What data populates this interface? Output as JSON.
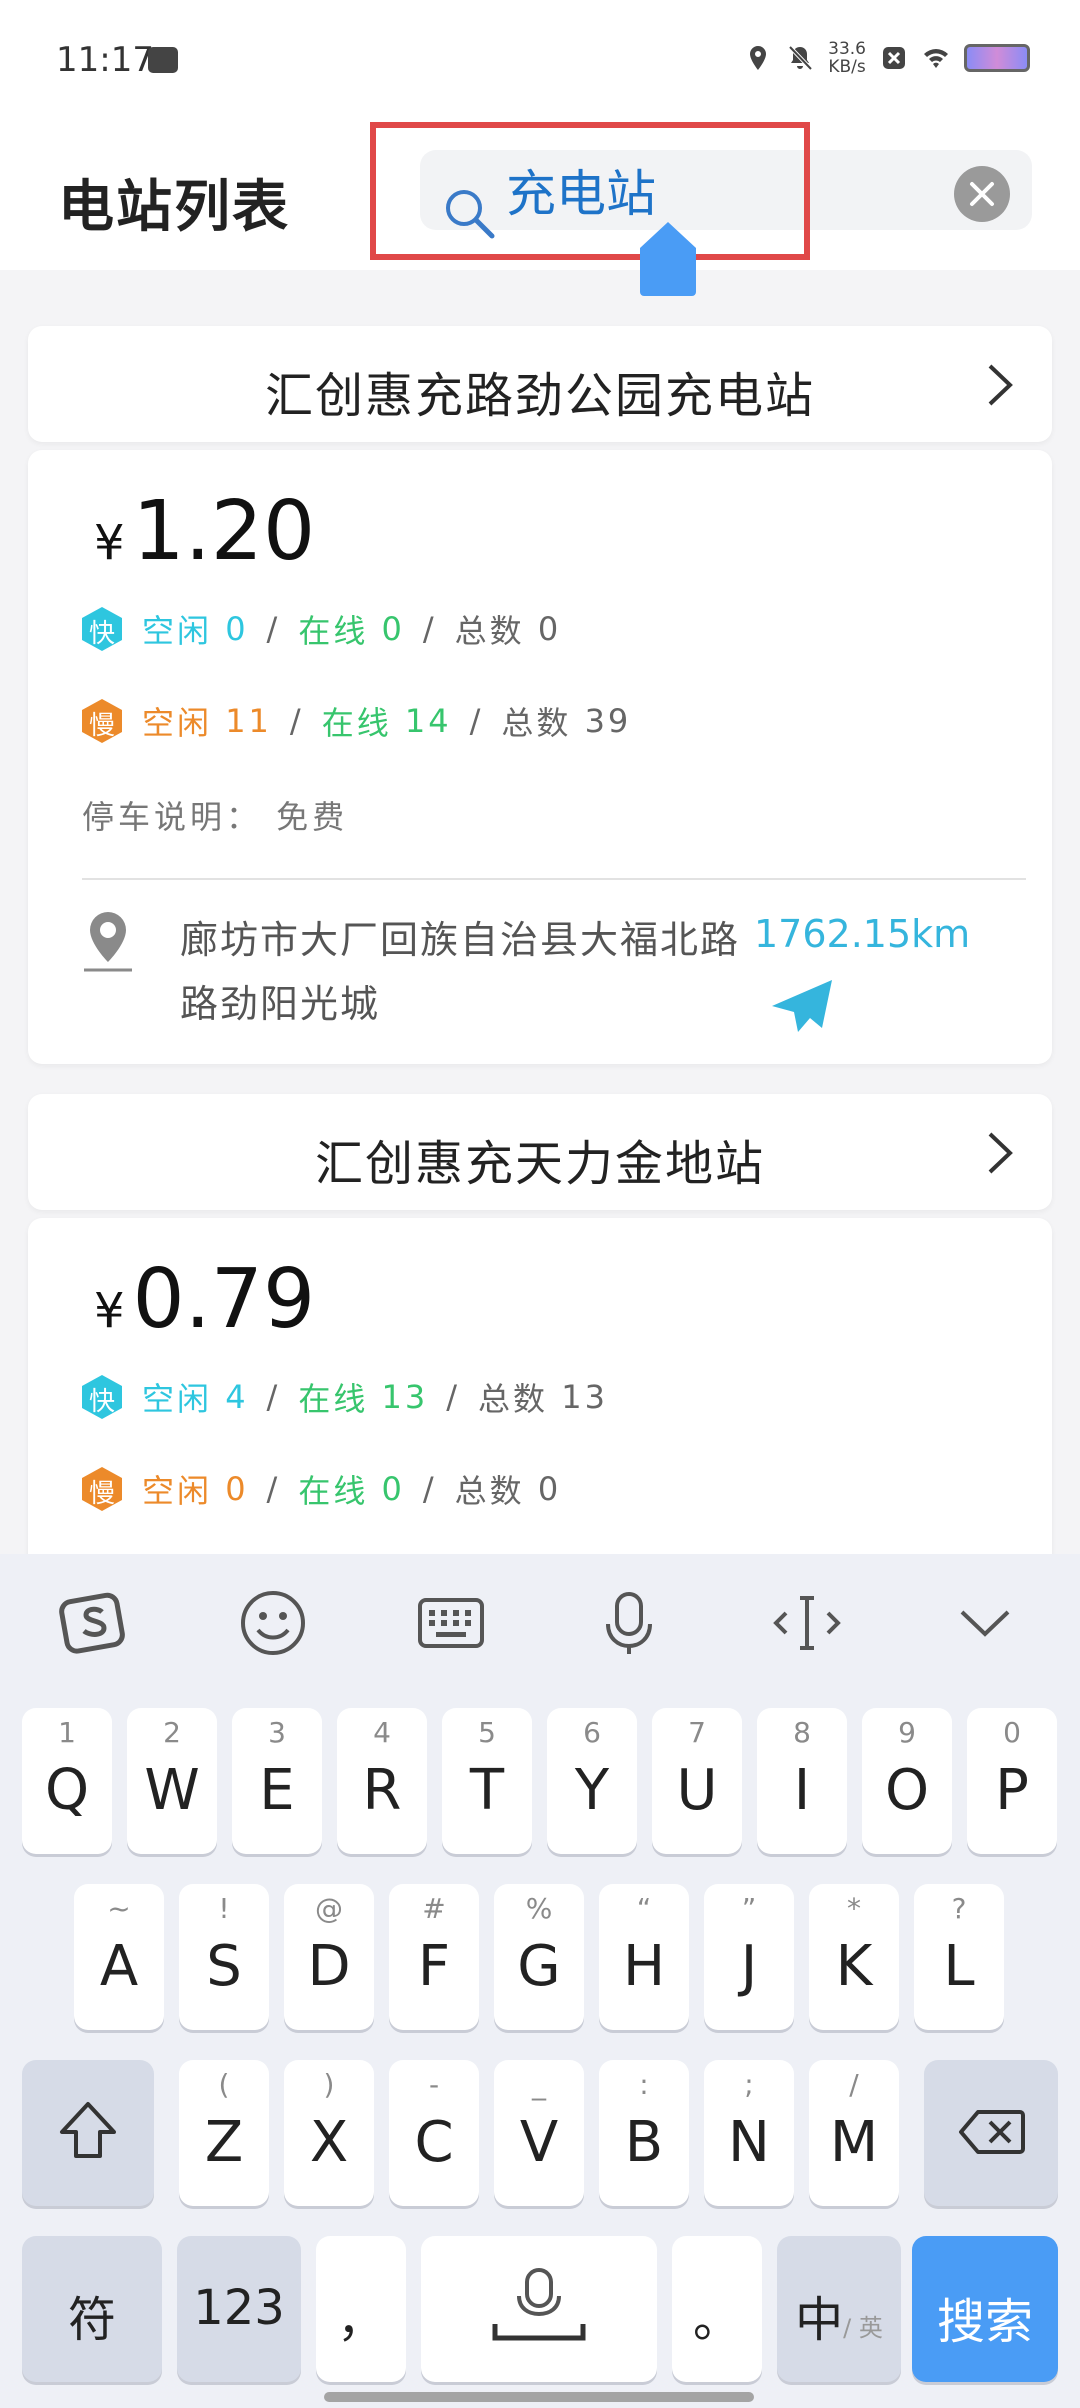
{
  "status_bar": {
    "time": "11:17",
    "speed_value": "33.6",
    "speed_unit": "KB/s",
    "icons": [
      "message-icon",
      "location-icon",
      "mute-icon",
      "close-box-icon",
      "wifi-icon",
      "battery-icon"
    ]
  },
  "header": {
    "title": "电站列表",
    "search_value": "充电站",
    "icons": [
      "search-icon",
      "clear-icon"
    ]
  },
  "stations": [
    {
      "name": "汇创惠充路劲公园充电站",
      "currency": "¥",
      "price": "1.20",
      "fast": {
        "badge": "快",
        "idle_label": "空闲",
        "idle": "0",
        "online_label": "在线",
        "online": "0",
        "total_label": "总数",
        "total": "0"
      },
      "slow": {
        "badge": "慢",
        "idle_label": "空闲",
        "idle": "11",
        "online_label": "在线",
        "online": "14",
        "total_label": "总数",
        "total": "39"
      },
      "parking": "停车说明： 免费",
      "address": "廊坊市大厂回族自治县大福北路路劲阳光城",
      "distance": "1762.15km"
    },
    {
      "name": "汇创惠充天力金地站",
      "currency": "¥",
      "price": "0.79",
      "fast": {
        "badge": "快",
        "idle_label": "空闲",
        "idle": "4",
        "online_label": "在线",
        "online": "13",
        "total_label": "总数",
        "total": "13"
      },
      "slow": {
        "badge": "慢",
        "idle_label": "空闲",
        "idle": "0",
        "online_label": "在线",
        "online": "0",
        "total_label": "总数",
        "total": "0"
      }
    }
  ],
  "keyboard": {
    "toolbar": [
      "sogou-logo-icon",
      "emoji-icon",
      "keyboard-icon",
      "microphone-icon",
      "cursor-icon",
      "collapse-icon"
    ],
    "row1": [
      {
        "hint": "1",
        "key": "Q"
      },
      {
        "hint": "2",
        "key": "W"
      },
      {
        "hint": "3",
        "key": "E"
      },
      {
        "hint": "4",
        "key": "R"
      },
      {
        "hint": "5",
        "key": "T"
      },
      {
        "hint": "6",
        "key": "Y"
      },
      {
        "hint": "7",
        "key": "U"
      },
      {
        "hint": "8",
        "key": "I"
      },
      {
        "hint": "9",
        "key": "O"
      },
      {
        "hint": "0",
        "key": "P"
      }
    ],
    "row2": [
      {
        "hint": "~",
        "key": "A"
      },
      {
        "hint": "!",
        "key": "S"
      },
      {
        "hint": "@",
        "key": "D"
      },
      {
        "hint": "#",
        "key": "F"
      },
      {
        "hint": "%",
        "key": "G"
      },
      {
        "hint": "“",
        "key": "H"
      },
      {
        "hint": "”",
        "key": "J"
      },
      {
        "hint": "*",
        "key": "K"
      },
      {
        "hint": "?",
        "key": "L"
      }
    ],
    "row3": [
      {
        "hint": "(",
        "key": "Z"
      },
      {
        "hint": ")",
        "key": "X"
      },
      {
        "hint": "-",
        "key": "C"
      },
      {
        "hint": "_",
        "key": "V"
      },
      {
        "hint": ":",
        "key": "B"
      },
      {
        "hint": ";",
        "key": "N"
      },
      {
        "hint": "/",
        "key": "M"
      }
    ],
    "symbol_key": "符",
    "number_key": "123",
    "comma_key": "，",
    "period_key": "。",
    "lang_key_main": "中",
    "lang_key_sub": "/ 英",
    "search_key": "搜索"
  },
  "colors": {
    "fast": "#2ec6df",
    "slow": "#ec8a2a",
    "online": "#37c56d",
    "distance": "#35b5dd",
    "search_text": "#1e73c8",
    "highlight": "#e04848",
    "search_key": "#4a9cf5"
  }
}
